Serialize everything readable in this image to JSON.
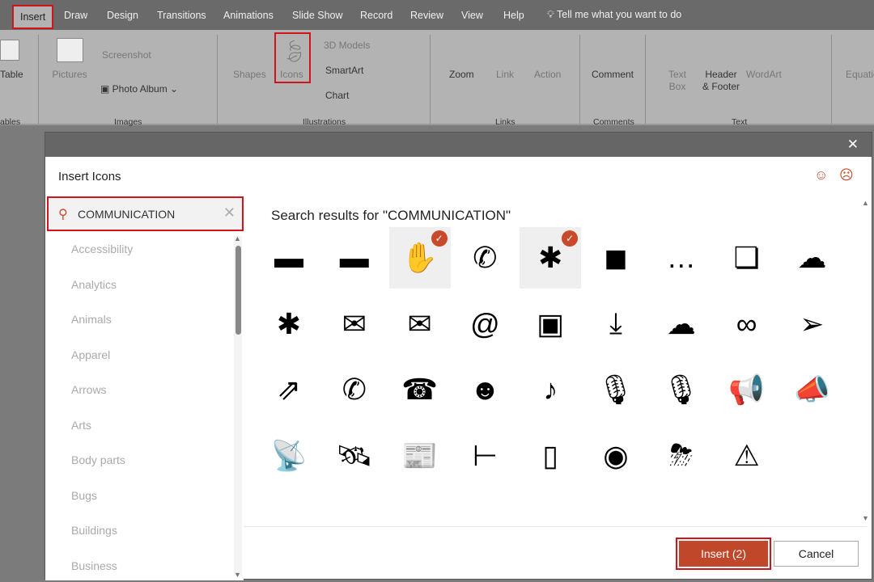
{
  "tabs": [
    "Insert",
    "Draw",
    "Design",
    "Transitions",
    "Animations",
    "Slide Show",
    "Record",
    "Review",
    "View",
    "Help"
  ],
  "tell_me": "Tell me what you want to do",
  "ribbon": {
    "table": "Table",
    "pictures": "Pictures",
    "screenshot": "Screenshot",
    "photo_album": "Photo Album",
    "shapes": "Shapes",
    "icons": "Icons",
    "models": "3D Models",
    "smartart": "SmartArt",
    "chart": "Chart",
    "zoom": "Zoom",
    "link": "Link",
    "action": "Action",
    "comment": "Comment",
    "textbox": "Text Box",
    "header": "Header & Footer",
    "wordart": "WordArt",
    "equation": "Equation",
    "groups": [
      "ables",
      "Images",
      "Illustrations",
      "Links",
      "Comments",
      "Text"
    ]
  },
  "dialog": {
    "title": "Insert Icons",
    "search_value": "COMMUNICATION",
    "categories": [
      "Accessibility",
      "Analytics",
      "Animals",
      "Apparel",
      "Arrows",
      "Arts",
      "Body parts",
      "Bugs",
      "Buildings",
      "Business"
    ],
    "results_heading": "Search results for \"COMMUNICATION\"",
    "icons": [
      {
        "name": "subtitles",
        "glyph": "▬",
        "selected": false
      },
      {
        "name": "speech-subtitles",
        "glyph": "▬",
        "selected": false
      },
      {
        "name": "sign-language",
        "glyph": "✋",
        "selected": true
      },
      {
        "name": "phone-vibrate",
        "glyph": "✆",
        "selected": false
      },
      {
        "name": "network",
        "glyph": "✱",
        "selected": true
      },
      {
        "name": "speech-bubble",
        "glyph": "◼",
        "selected": false
      },
      {
        "name": "chat-dots",
        "glyph": "…",
        "selected": false
      },
      {
        "name": "conversation",
        "glyph": "❏",
        "selected": false
      },
      {
        "name": "thought-bubble",
        "glyph": "☁",
        "selected": false
      },
      {
        "name": "hub",
        "glyph": "✱",
        "selected": false
      },
      {
        "name": "envelope",
        "glyph": "✉",
        "selected": false
      },
      {
        "name": "open-letter",
        "glyph": "✉",
        "selected": false
      },
      {
        "name": "email-at",
        "glyph": "@",
        "selected": false
      },
      {
        "name": "stamp",
        "glyph": "▣",
        "selected": false
      },
      {
        "name": "download",
        "glyph": "⤓",
        "selected": false
      },
      {
        "name": "cloud-download",
        "glyph": "☁",
        "selected": false
      },
      {
        "name": "link",
        "glyph": "∞",
        "selected": false
      },
      {
        "name": "paper-plane",
        "glyph": "➢",
        "selected": false
      },
      {
        "name": "share",
        "glyph": "⇗",
        "selected": false
      },
      {
        "name": "phone",
        "glyph": "✆",
        "selected": false
      },
      {
        "name": "telephone",
        "glyph": "☎",
        "selected": false
      },
      {
        "name": "headset-user",
        "glyph": "☻",
        "selected": false
      },
      {
        "name": "microphone-cable",
        "glyph": "♪",
        "selected": false
      },
      {
        "name": "microphone",
        "glyph": "🎙",
        "selected": false
      },
      {
        "name": "microphone-broadcast",
        "glyph": "🎙",
        "selected": false
      },
      {
        "name": "speaker-megaphone",
        "glyph": "📢",
        "selected": false
      },
      {
        "name": "megaphone",
        "glyph": "📣",
        "selected": false
      },
      {
        "name": "satellite-dish",
        "glyph": "📡",
        "selected": false
      },
      {
        "name": "satellite",
        "glyph": "🛰",
        "selected": false
      },
      {
        "name": "newspaper",
        "glyph": "📰",
        "selected": false
      },
      {
        "name": "hierarchy",
        "glyph": "⊢",
        "selected": false
      },
      {
        "name": "mobile-phone",
        "glyph": "▯",
        "selected": false
      },
      {
        "name": "webcam",
        "glyph": "◉",
        "selected": false
      },
      {
        "name": "storm-cloud",
        "glyph": "⛈",
        "selected": false
      },
      {
        "name": "radio-tower",
        "glyph": "⚠",
        "selected": false
      }
    ],
    "insert_label": "Insert (2)",
    "cancel_label": "Cancel"
  },
  "colors": {
    "accent": "#c0472a",
    "highlight": "#d0141b"
  }
}
